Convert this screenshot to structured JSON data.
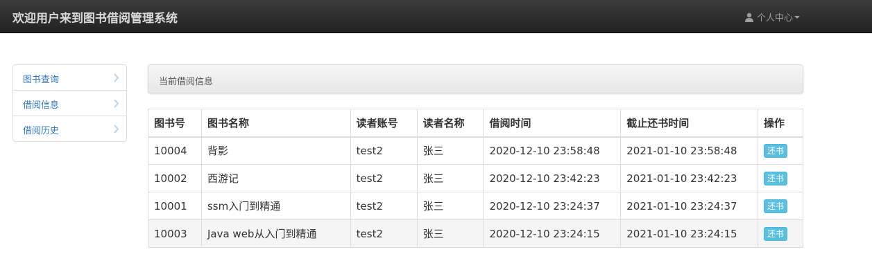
{
  "navbar": {
    "brand": "欢迎用户来到图书借阅管理系统",
    "user_menu_label": "个人中心",
    "user_icon": "user-icon",
    "caret_icon": "caret-down-icon"
  },
  "sidebar": {
    "items": [
      {
        "label": "图书查询",
        "icon": "chevron-right-icon"
      },
      {
        "label": "借阅信息",
        "icon": "chevron-right-icon"
      },
      {
        "label": "借阅历史",
        "icon": "chevron-right-icon"
      }
    ]
  },
  "main": {
    "panel_title": "当前借阅信息",
    "table": {
      "headers": [
        "图书号",
        "图书名称",
        "读者账号",
        "读者名称",
        "借阅时间",
        "截止还书时间",
        "操作"
      ],
      "rows": [
        {
          "book_id": "10004",
          "title": "背影",
          "reader_account": "test2",
          "reader_name": "张三",
          "borrow_time": "2020-12-10 23:58:48",
          "due_time": "2021-01-10 23:58:48",
          "action": "还书"
        },
        {
          "book_id": "10002",
          "title": "西游记",
          "reader_account": "test2",
          "reader_name": "张三",
          "borrow_time": "2020-12-10 23:42:23",
          "due_time": "2021-01-10 23:42:23",
          "action": "还书"
        },
        {
          "book_id": "10001",
          "title": "ssm入门到精通",
          "reader_account": "test2",
          "reader_name": "张三",
          "borrow_time": "2020-12-10 23:24:37",
          "due_time": "2021-01-10 23:24:37",
          "action": "还书"
        },
        {
          "book_id": "10003",
          "title": "Java web从入门到精通",
          "reader_account": "test2",
          "reader_name": "张三",
          "borrow_time": "2020-12-10 23:24:15",
          "due_time": "2021-01-10 23:24:15",
          "action": "还书"
        }
      ]
    }
  },
  "colors": {
    "navbar_bg": "#222222",
    "link": "#337ab7",
    "button_info": "#5bc0de"
  }
}
